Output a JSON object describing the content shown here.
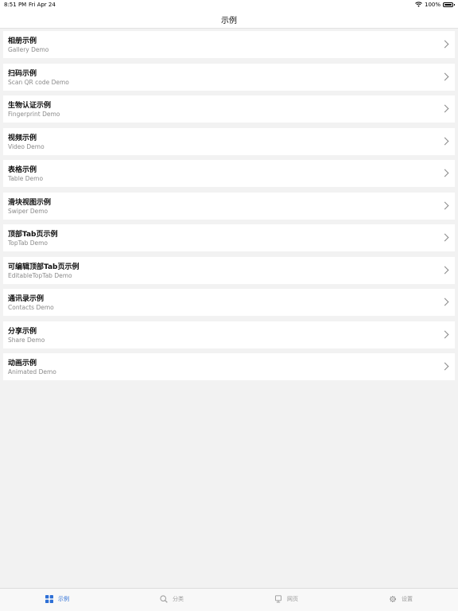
{
  "status_bar": {
    "time": "8:51 PM",
    "date": "Fri Apr 24",
    "battery": "100%",
    "battery_level": 1.0
  },
  "nav": {
    "title": "示例"
  },
  "list": {
    "items": [
      {
        "title": "相册示例",
        "subtitle": "Gallery Demo"
      },
      {
        "title": "扫码示例",
        "subtitle": "Scan QR code Demo"
      },
      {
        "title": "生物认证示例",
        "subtitle": "Fingerprint Demo"
      },
      {
        "title": "视频示例",
        "subtitle": "Video Demo"
      },
      {
        "title": "表格示例",
        "subtitle": "Table Demo"
      },
      {
        "title": "滑块视图示例",
        "subtitle": "Swiper Demo"
      },
      {
        "title": "顶部Tab页示例",
        "subtitle": "TopTab Demo"
      },
      {
        "title": "可编辑顶部Tab页示例",
        "subtitle": "EditableTopTab Demo"
      },
      {
        "title": "通讯录示例",
        "subtitle": "Contacts Demo"
      },
      {
        "title": "分享示例",
        "subtitle": "Share Demo"
      },
      {
        "title": "动画示例",
        "subtitle": "Animated Demo"
      }
    ]
  },
  "tab_bar": {
    "tabs": [
      {
        "label": "示例",
        "icon": "grid-icon",
        "active": true
      },
      {
        "label": "分类",
        "icon": "search-icon",
        "active": false
      },
      {
        "label": "网页",
        "icon": "monitor-icon",
        "active": false
      },
      {
        "label": "设置",
        "icon": "gear-icon",
        "active": false
      }
    ]
  },
  "colors": {
    "accent": "#2d6fd6",
    "background": "#f2f2f2",
    "inactive_tab": "#9a9a9a"
  }
}
